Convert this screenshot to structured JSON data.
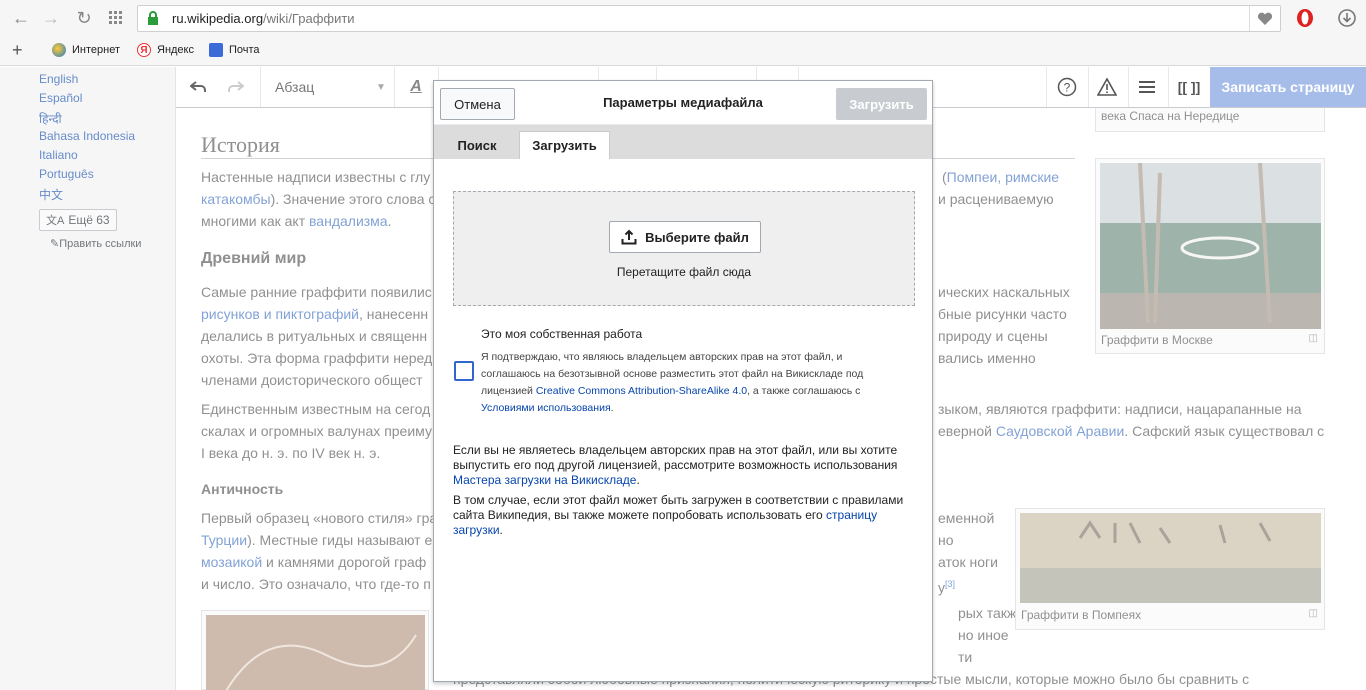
{
  "browser": {
    "url_host": "ru.wikipedia.org",
    "url_path": "/wiki/Граффити",
    "bookmarks": [
      "Интернет",
      "Яндекс",
      "Почта"
    ],
    "add_tab": "+"
  },
  "sidebar": {
    "languages": [
      "English",
      "Español",
      "हिन्दी",
      "Bahasa Indonesia",
      "Italiano",
      "Português",
      "中文"
    ],
    "more_languages": "Ещё 63",
    "edit_links": "Править ссылки"
  },
  "toolbar": {
    "paragraph_label": "Абзац",
    "save_page": "Записать страницу"
  },
  "article": {
    "section_history": "История",
    "p1": {
      "line1a": "Настенные надписи известны с глу",
      "line1b_pre": "(",
      "line1b_link": "Помпеи, римские",
      "line2a_link": "катакомбы",
      "line2a": "). Значение этого слова с",
      "line2b": "и расцениваемую",
      "line3a": "многими как акт ",
      "line3_link": "вандализма",
      "line3b": "."
    },
    "section_ancient": "Древний мир",
    "p2": {
      "l1a": "Самые ранние граффити появилис",
      "l1b": "ических наскальных",
      "l2a_link": "рисунков и пиктографий",
      "l2a": ", нанесенн",
      "l2b": "бные рисунки часто",
      "l3a": "делались в ритуальных и священн",
      "l3b": "природу и сцены",
      "l4a": "охоты. Эта форма граффити неред",
      "l4b": "вались именно",
      "l5a": "членами доисторического общест"
    },
    "p3": {
      "l1a": "Единственным известным на сегод",
      "l1b": "зыком, являются граффити: надписи, нацарапанные на",
      "l2a": "скалах и огромных валунах преиму",
      "l2b": "еверной ",
      "l2_link": "Саудовской Аравии",
      "l2c": ". Сафский язык существовал с",
      "l3a": "I века до н. э. по IV век н. э."
    },
    "section_antiquity": "Античность",
    "p4": {
      "l1a": "Первый образец «нового стиля» гра",
      "l1b": "еменной",
      "l2a_link": "Турции",
      "l2a": "). Местные гиды называют е",
      "l2b": "но",
      "l3a_link": "мозаикой",
      "l3a": " и камнями дорогой граф",
      "l3b": "аток ноги",
      "l4a": "и число. Это означало, что где-то п",
      "l4b": "у",
      "l4_ref": "[3]"
    },
    "p5": {
      "l1b": "рых также",
      "l2b": "но иное",
      "l3b": "ти",
      "l4": "представляли собой любовные признания, политическую риторику и простые мысли, которые можно было бы сравнить с"
    },
    "caption_nereditsa": "века Спаса на Нередице",
    "caption_moscow": "Граффити в Москве",
    "caption_pompeii": "Граффити в Помпеях"
  },
  "dialog": {
    "cancel": "Отмена",
    "title": "Параметры медиафайла",
    "upload": "Загрузить",
    "tabs": [
      "Поиск",
      "Загрузить"
    ],
    "choose_file": "Выберите файл",
    "drop_hint": "Перетащите файл сюда",
    "own_work": "Это моя собственная работа",
    "consent_pre": "Я подтверждаю, что являюсь владельцем авторских прав на этот файл, и соглашаюсь на безотзывной основе разместить этот файл на Викискладе под лицензией ",
    "consent_license": "Creative Commons Attribution-ShareAlike 4.0",
    "consent_mid": ", а также соглашаюсь с ",
    "consent_terms": "Условиями использования",
    "consent_end": ".",
    "info1_pre": "Если вы не являетесь владельцем авторских прав на этот файл, или вы хотите выпустить его под другой лицензией, рассмотрите возможность использования ",
    "info1_link": "Мастера загрузки на Викискладе",
    "info1_end": ".",
    "info2_pre": "В том случае, если этот файл может быть загружен в соответствии с правилами сайта Википедия, вы также можете попробовать использовать его ",
    "info2_link": "страницу загрузки",
    "info2_end": "."
  }
}
